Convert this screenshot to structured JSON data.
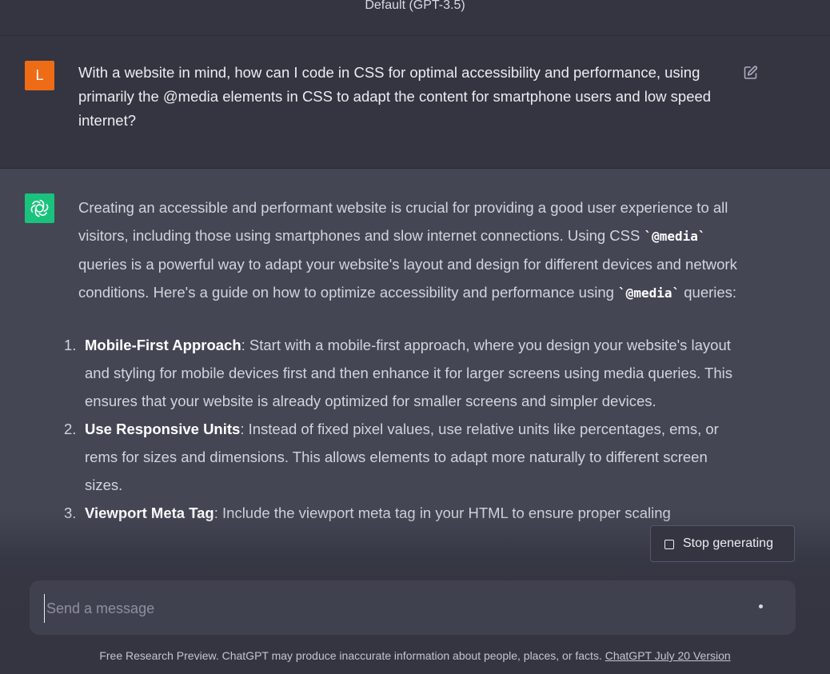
{
  "header": {
    "title": "Default (GPT-3.5)"
  },
  "user_message": {
    "avatar_letter": "L",
    "avatar_color": "#ef6c16",
    "text": "With a website in mind, how can I code in CSS for optimal accessibility and performance, using primarily the @media elements in CSS to adapt the content for smartphone users and low speed internet?",
    "edit_icon": "edit-icon"
  },
  "assistant_message": {
    "avatar_icon": "openai-logo-icon",
    "avatar_color": "#19c37d",
    "intro_part1": "Creating an accessible and performant website is crucial for providing a good user experience to all visitors, including those using smartphones and slow internet connections. Using CSS ",
    "intro_code1": "`@media`",
    "intro_part2": " queries is a powerful way to adapt your website's layout and design for different devices and network conditions. Here's a guide on how to optimize accessibility and performance using ",
    "intro_code2": "`@media`",
    "intro_part3": " queries:",
    "list": [
      {
        "num": "1.",
        "title": "Mobile-First Approach",
        "body": ": Start with a mobile-first approach, where you design your website's layout and styling for mobile devices first and then enhance it for larger screens using media queries. This ensures that your website is already optimized for smaller screens and simpler devices."
      },
      {
        "num": "2.",
        "title": "Use Responsive Units",
        "body": ": Instead of fixed pixel values, use relative units like percentages, ems, or rems for sizes and dimensions. This allows elements to adapt more naturally to different screen sizes."
      },
      {
        "num": "3.",
        "title": "Viewport Meta Tag",
        "body": ": Include the viewport meta tag in your HTML to ensure proper scaling"
      }
    ]
  },
  "stop_button": {
    "label": "Stop generating"
  },
  "composer": {
    "placeholder": "Send a message"
  },
  "footer": {
    "text": "Free Research Preview. ChatGPT may produce inaccurate information about people, places, or facts. ",
    "link": "ChatGPT July 20 Version"
  }
}
